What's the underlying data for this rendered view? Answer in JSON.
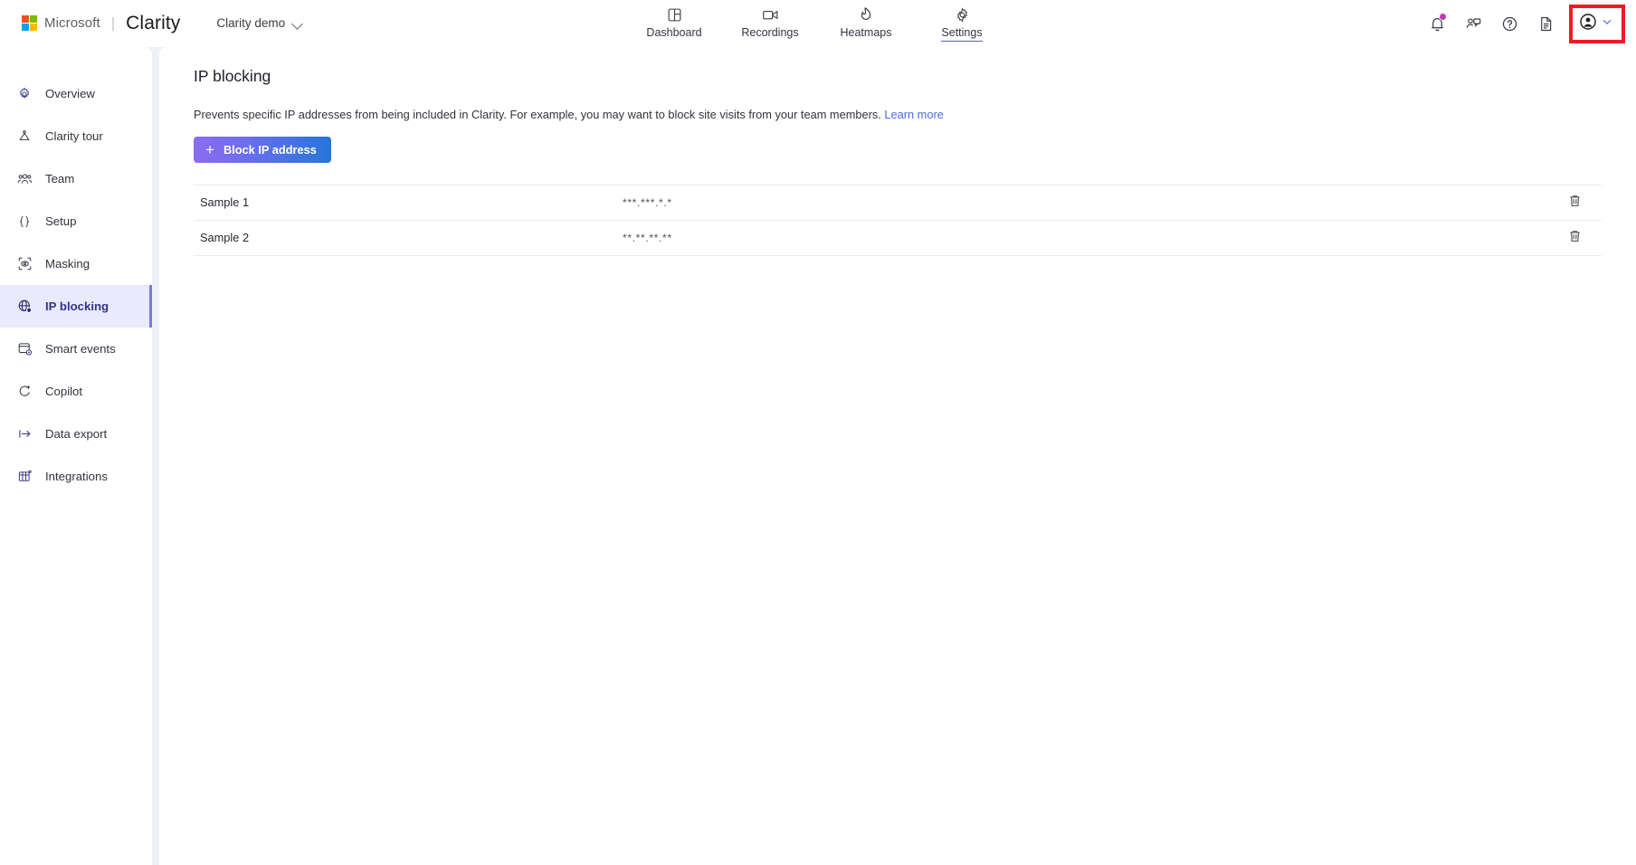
{
  "topbar": {
    "microsoft": "Microsoft",
    "product": "Clarity",
    "separator": "|",
    "project": "Clarity demo",
    "nav": [
      {
        "label": "Dashboard",
        "icon": "dashboard-icon",
        "active": false
      },
      {
        "label": "Recordings",
        "icon": "video-camera-icon",
        "active": false
      },
      {
        "label": "Heatmaps",
        "icon": "flame-icon",
        "active": false
      },
      {
        "label": "Settings",
        "icon": "gear-icon",
        "active": true
      }
    ],
    "actions": [
      {
        "name": "notifications-bell-icon",
        "has_badge": true
      },
      {
        "name": "feedback-icon",
        "has_badge": false
      },
      {
        "name": "help-icon",
        "has_badge": false
      },
      {
        "name": "documentation-icon",
        "has_badge": false
      }
    ],
    "account": {
      "name": "account-icon",
      "chevron": "chevron-down-icon",
      "highlight_color": "#ed1c24"
    }
  },
  "sidebar": {
    "items": [
      {
        "label": "Overview",
        "icon": "gear-icon",
        "active": false
      },
      {
        "label": "Clarity tour",
        "icon": "tour-icon",
        "active": false
      },
      {
        "label": "Team",
        "icon": "people-icon",
        "active": false
      },
      {
        "label": "Setup",
        "icon": "braces-icon",
        "active": false
      },
      {
        "label": "Masking",
        "icon": "mask-icon",
        "active": false
      },
      {
        "label": "IP blocking",
        "icon": "globe-block-icon",
        "active": true
      },
      {
        "label": "Smart events",
        "icon": "smart-events-icon",
        "active": false
      },
      {
        "label": "Copilot",
        "icon": "copilot-icon",
        "active": false
      },
      {
        "label": "Data export",
        "icon": "export-icon",
        "active": false
      },
      {
        "label": "Integrations",
        "icon": "integrations-icon",
        "active": false
      }
    ]
  },
  "main": {
    "title": "IP blocking",
    "description": "Prevents specific IP addresses from being included in Clarity. For example, you may want to block site visits from your team members.",
    "learn_more": "Learn more",
    "add_button": "Block IP address",
    "rows": [
      {
        "name": "Sample 1",
        "ip": "***.***.*.*",
        "action": "delete-icon"
      },
      {
        "name": "Sample 2",
        "ip": "**.**.**.**",
        "action": "delete-icon"
      }
    ]
  },
  "colors": {
    "accent": "#5b5fc7",
    "link": "#4a6ee0",
    "active_nav_bg": "#e9eafc",
    "highlight": "#ed1c24",
    "badge": "#c239b3",
    "page_bg": "#eef1f8"
  }
}
